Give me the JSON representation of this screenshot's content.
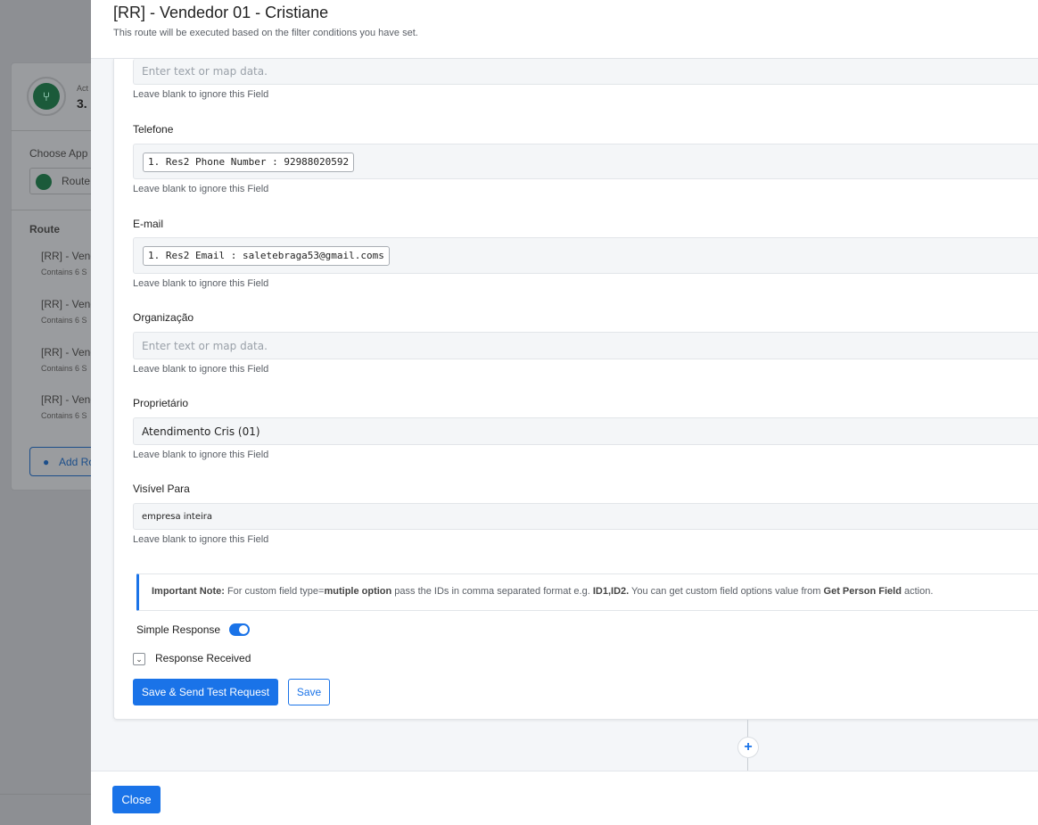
{
  "background": {
    "step_label_partial": "Act",
    "step_number_partial": "3.",
    "choose_app_label": "Choose App",
    "app_select_value": "Route",
    "route_heading": "Route",
    "routes": [
      {
        "name": "[RR] - Vend",
        "sub": "Contains 6 S"
      },
      {
        "name": "[RR] - Vend",
        "sub": "Contains 6 S"
      },
      {
        "name": "[RR] - Vend",
        "sub": "Contains 6 S"
      },
      {
        "name": "[RR] - Vend",
        "sub": "Contains 6 S"
      }
    ],
    "add_route_label": "Add Ro"
  },
  "drawer": {
    "title": "[RR] - Vendedor 01 - Cristiane",
    "subtitle": "This route will be executed based on the filter conditions you have set."
  },
  "fields": {
    "top_placeholder": "Enter text or map data.",
    "hint": "Leave blank to ignore this Field",
    "telefone": {
      "label": "Telefone",
      "chip": "1. Res2 Phone Number : 92988020592"
    },
    "email": {
      "label": "E-mail",
      "chip": "1. Res2 Email : saletebraga53@gmail.coms"
    },
    "organizacao": {
      "label": "Organização",
      "placeholder": "Enter text or map data."
    },
    "proprietario": {
      "label": "Proprietário",
      "value": "Atendimento Cris (01)"
    },
    "visivel": {
      "label": "Visível Para",
      "value": "empresa inteira"
    }
  },
  "note": {
    "prefix": "Important Note:",
    "t1": " For custom field type=",
    "b1": "mutiple option",
    "t2": " pass the IDs in comma separated format e.g. ",
    "b2": "ID1,ID2.",
    "t3": " You can get custom field options value from ",
    "b3": "Get Person Field",
    "t4": " action."
  },
  "simple_response_label": "Simple Response",
  "simple_response_on": true,
  "response_received_label": "Response Received",
  "buttons": {
    "save_send": "Save & Send Test Request",
    "save": "Save",
    "close": "Close"
  },
  "colors": {
    "accent": "#1a73e8"
  }
}
